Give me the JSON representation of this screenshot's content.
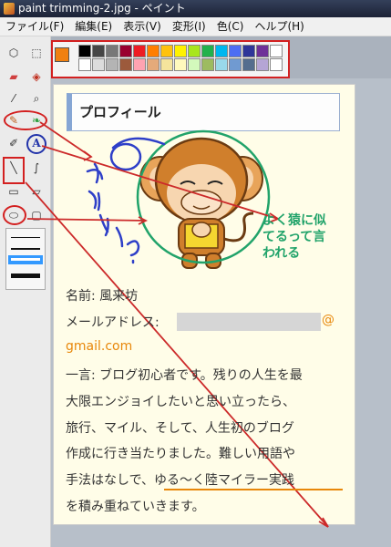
{
  "window": {
    "title": "paint trimming-2.jpg - ペイント"
  },
  "menu": [
    "ファイル(F)",
    "編集(E)",
    "表示(V)",
    "変形(I)",
    "色(C)",
    "ヘルプ(H)"
  ],
  "colors": {
    "accent_red": "#d32020",
    "accent_blue": "#2233aa",
    "annotation_green": "#21a36a",
    "orange_text": "#e8870a",
    "primary_color": "#f08010",
    "palette_row1": [
      "#000000",
      "#464646",
      "#787878",
      "#990030",
      "#ed1c24",
      "#ff7e00",
      "#ffc20e",
      "#fff200",
      "#a8e61d",
      "#22b14c",
      "#00b7ef",
      "#4d6df3",
      "#2f3699",
      "#6f3198",
      "#ffffff"
    ],
    "palette_row2": [
      "#ffffff",
      "#dcdcdc",
      "#b4b4b4",
      "#9c5a3c",
      "#ffa3b1",
      "#e5aa7a",
      "#f5e49c",
      "#fff9bd",
      "#d3f9bc",
      "#9dbb61",
      "#99d9ea",
      "#709ad1",
      "#546d8e",
      "#b5a5d5",
      "#ffffff"
    ]
  },
  "tools": [
    "free-select-icon",
    "rect-select-icon",
    "eraser-icon",
    "fill-icon",
    "eyedropper-icon",
    "magnifier-icon",
    "pencil-icon",
    "brush-icon",
    "airbrush-icon",
    "text-icon",
    "line-icon",
    "curve-icon",
    "rectangle-icon",
    "polygon-icon",
    "ellipse-icon",
    "rounded-rect-icon"
  ],
  "content": {
    "heading": "プロフィール",
    "name_line": "名前: 風来坊",
    "email_label": "メールアドレス:",
    "email_at": "@",
    "email_domain": "gmail.com",
    "line1": "一言: ブログ初心者です。残りの人生を最",
    "line2": "大限エンジョイしたいと思い立ったら、",
    "line3": "旅行、マイル、そして、人生初のブログ",
    "line4": "作成に行き当たりました。難しい用語や",
    "line5_a": "手法はなしで、",
    "line5_b": "ゆる〜く陸マイラー実践",
    "line6": "を積み重ねていきます。",
    "annotation": [
      "よく猿に似",
      "てるって言",
      "われる"
    ],
    "doodle_text": "かわいい？"
  }
}
